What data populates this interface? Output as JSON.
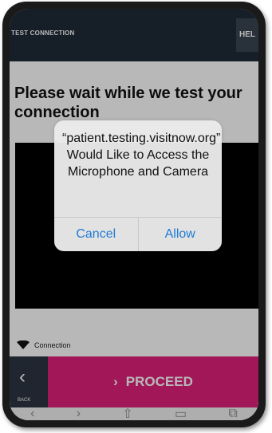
{
  "topbar": {
    "tab_label": "TEST CONNECTION",
    "help_label": "HEL"
  },
  "content": {
    "heading": "Please wait while we test your connection",
    "status_label": "Connection"
  },
  "bottom": {
    "back_label": "BACK",
    "proceed_label": "PROCEED"
  },
  "alert": {
    "message": "“patient.testing.visitnow.org” Would Like to Access the Microphone and Camera",
    "cancel_label": "Cancel",
    "allow_label": "Allow"
  },
  "icons": [
    "wifi-icon",
    "chevron-left-icon",
    "chevron-right-icon",
    "share-icon",
    "book-icon",
    "tabs-icon"
  ],
  "colors": {
    "nav": "#1f2a36",
    "proceed": "#e0207a",
    "link": "#1e7ad6"
  }
}
